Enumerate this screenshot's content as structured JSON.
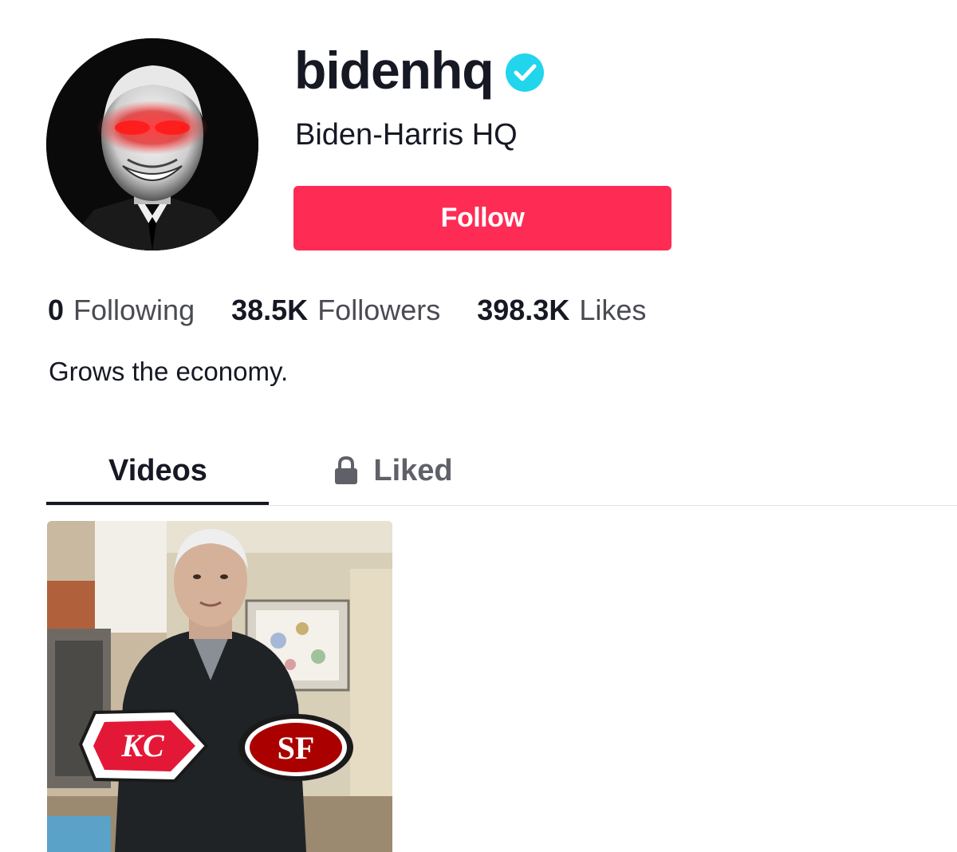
{
  "profile": {
    "username": "bidenhq",
    "verified": true,
    "nickname": "Biden-Harris HQ",
    "follow_label": "Follow",
    "bio": "Grows the economy."
  },
  "stats": [
    {
      "num": "0",
      "label": "Following"
    },
    {
      "num": "38.5K",
      "label": "Followers"
    },
    {
      "num": "398.3K",
      "label": "Likes"
    }
  ],
  "tabs": [
    {
      "label": "Videos",
      "selected": true,
      "icon": null
    },
    {
      "label": "Liked",
      "selected": false,
      "icon": "lock-icon"
    }
  ],
  "video": {
    "logos": [
      "KC",
      "SF"
    ]
  },
  "colors": {
    "follow_button": "#fe2c55",
    "verified_badge": "#20d5ec",
    "text_primary": "#161823",
    "text_secondary": "#4a4b52"
  }
}
